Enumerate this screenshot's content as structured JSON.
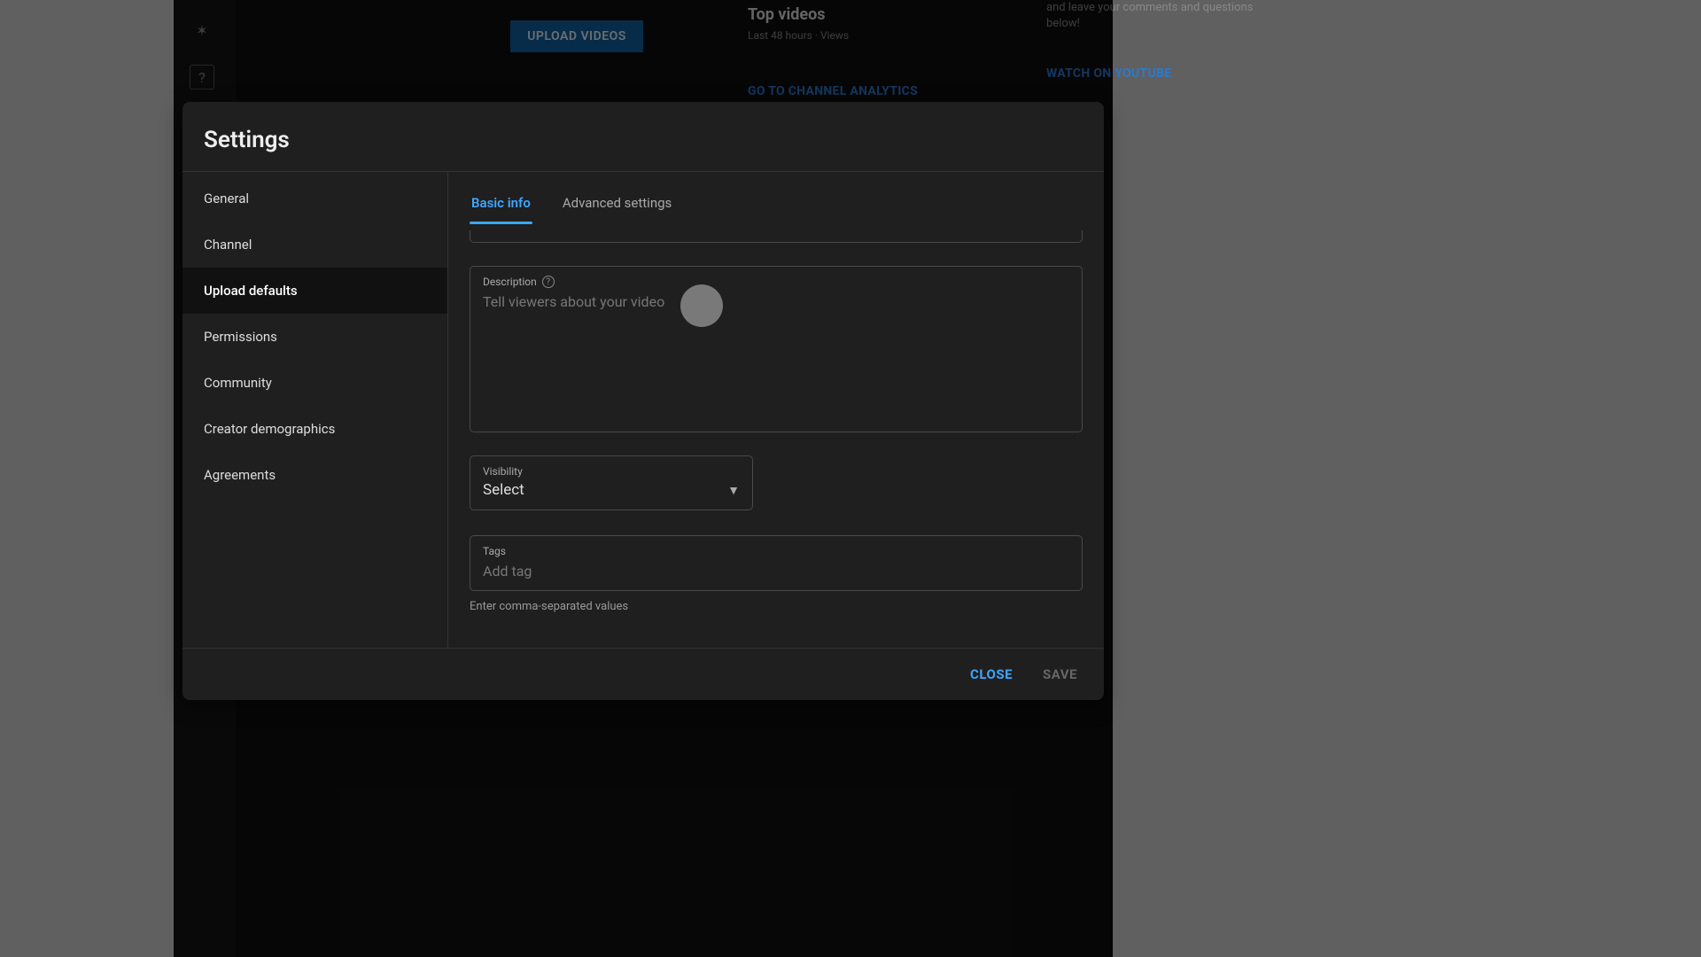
{
  "background": {
    "upload_button": "UPLOAD VIDEOS",
    "top_videos": {
      "title": "Top videos",
      "subtitle": "Last 48 hours · Views",
      "link": "GO TO CHANNEL ANALYTICS"
    },
    "promo": {
      "text": "and leave your comments and questions below!",
      "link": "WATCH ON YOUTUBE"
    }
  },
  "modal": {
    "title": "Settings",
    "sidebar": {
      "items": [
        {
          "label": "General"
        },
        {
          "label": "Channel"
        },
        {
          "label": "Upload defaults"
        },
        {
          "label": "Permissions"
        },
        {
          "label": "Community"
        },
        {
          "label": "Creator demographics"
        },
        {
          "label": "Agreements"
        }
      ],
      "active_index": 2
    },
    "tabs": [
      {
        "label": "Basic info"
      },
      {
        "label": "Advanced settings"
      }
    ],
    "active_tab": 0,
    "fields": {
      "description": {
        "label": "Description",
        "placeholder": "Tell viewers about your video"
      },
      "visibility": {
        "label": "Visibility",
        "value": "Select"
      },
      "tags": {
        "label": "Tags",
        "placeholder": "Add tag",
        "helper": "Enter comma-separated values"
      }
    },
    "footer": {
      "close": "CLOSE",
      "save": "SAVE"
    }
  },
  "colors": {
    "accent": "#3ea6ff",
    "modal_bg": "#1f1f1f"
  }
}
